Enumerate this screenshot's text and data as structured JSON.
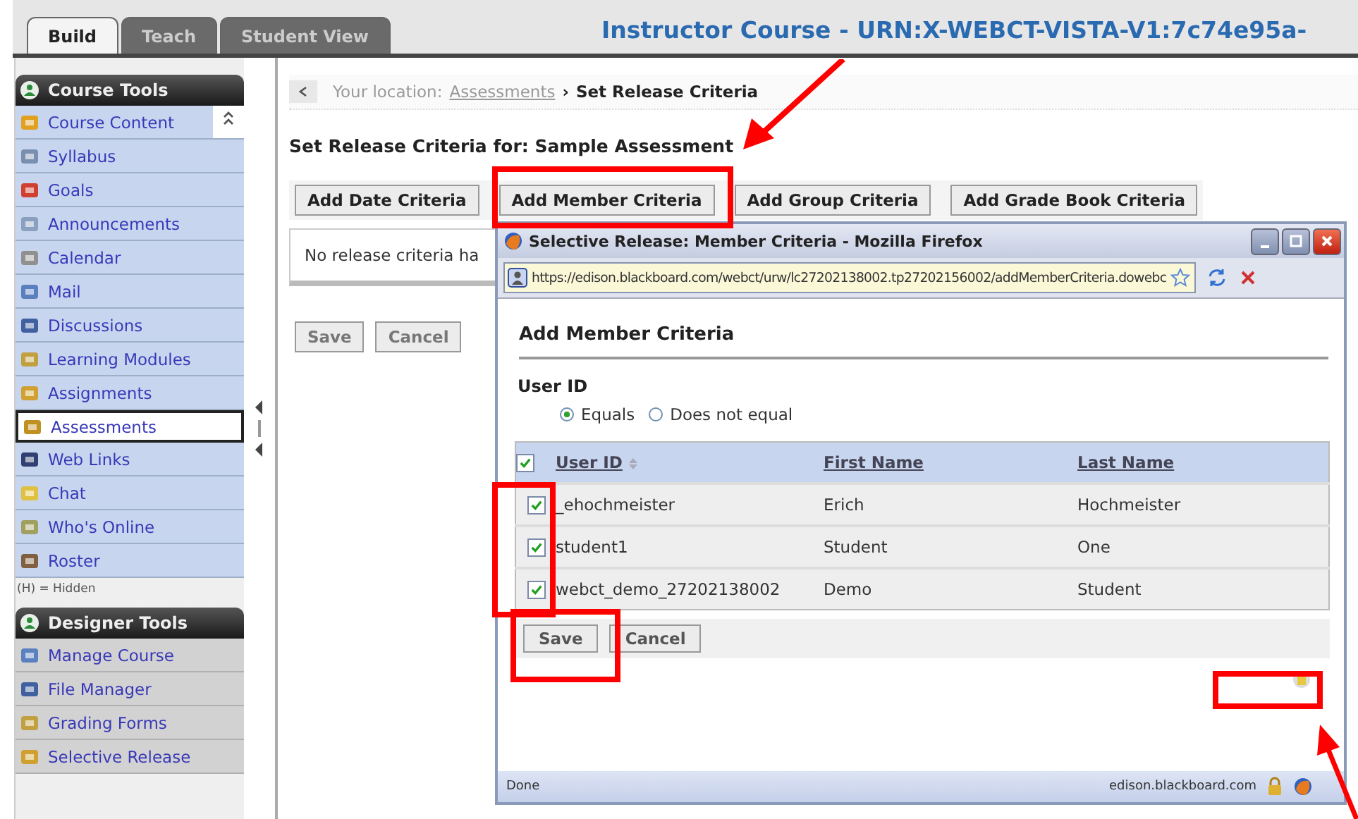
{
  "tabs": [
    {
      "label": "Build",
      "selected": true
    },
    {
      "label": "Teach",
      "selected": false
    },
    {
      "label": "Student View",
      "selected": false
    }
  ],
  "course_title": "Instructor Course - URN:X-WEBCT-VISTA-V1:7c74e95a-",
  "sidebar": {
    "sections": [
      {
        "title": "Course Tools",
        "items": [
          {
            "label": "Course Content",
            "selected": false,
            "expanded": true
          },
          {
            "label": "Syllabus",
            "selected": false
          },
          {
            "label": "Goals",
            "selected": false
          },
          {
            "label": "Announcements",
            "selected": false
          },
          {
            "label": "Calendar",
            "selected": false
          },
          {
            "label": "Mail",
            "selected": false
          },
          {
            "label": "Discussions",
            "selected": false
          },
          {
            "label": "Learning Modules",
            "selected": false
          },
          {
            "label": "Assignments",
            "selected": false
          },
          {
            "label": "Assessments",
            "selected": true
          },
          {
            "label": "Web Links",
            "selected": false
          },
          {
            "label": "Chat",
            "selected": false
          },
          {
            "label": "Who's Online",
            "selected": false
          },
          {
            "label": "Roster",
            "selected": false
          }
        ],
        "note": "(H) = Hidden"
      },
      {
        "title": "Designer Tools",
        "items": [
          {
            "label": "Manage Course",
            "selected": false
          },
          {
            "label": "File Manager",
            "selected": false
          },
          {
            "label": "Grading Forms",
            "selected": false
          },
          {
            "label": "Selective Release",
            "selected": false
          }
        ]
      }
    ]
  },
  "breadcrumb": {
    "label": "Your location:",
    "link": "Assessments",
    "separator": "›",
    "current": "Set Release Criteria"
  },
  "heading": "Set Release Criteria for: Sample Assessment",
  "criteria_buttons": [
    "Add Date Criteria",
    "Add Member Criteria",
    "Add Group Criteria",
    "Add Grade Book Criteria"
  ],
  "message": "No release criteria ha",
  "form_buttons": [
    "Save",
    "Cancel"
  ],
  "popup": {
    "title": "Selective Release: Member Criteria - Mozilla Firefox",
    "url": "https://edison.blackboard.com/webct/urw/lc27202138002.tp27202156002/addMemberCriteria.dowebc",
    "heading": "Add Member Criteria",
    "field_label": "User ID",
    "radios": [
      {
        "label": "Equals",
        "selected": true
      },
      {
        "label": "Does not equal",
        "selected": false
      }
    ],
    "select_all": true,
    "columns": [
      "User ID",
      "First Name",
      "Last Name"
    ],
    "rows": [
      {
        "checked": true,
        "cells": [
          "_ehochmeister",
          "Erich",
          "Hochmeister"
        ]
      },
      {
        "checked": true,
        "cells": [
          "student1",
          "Student",
          "One"
        ]
      },
      {
        "checked": true,
        "cells": [
          "webct_demo_27202138002",
          "Demo",
          "Student"
        ]
      }
    ],
    "buttons": [
      "Save",
      "Cancel"
    ],
    "status": "Done",
    "host": "edison.blackboard.com"
  }
}
